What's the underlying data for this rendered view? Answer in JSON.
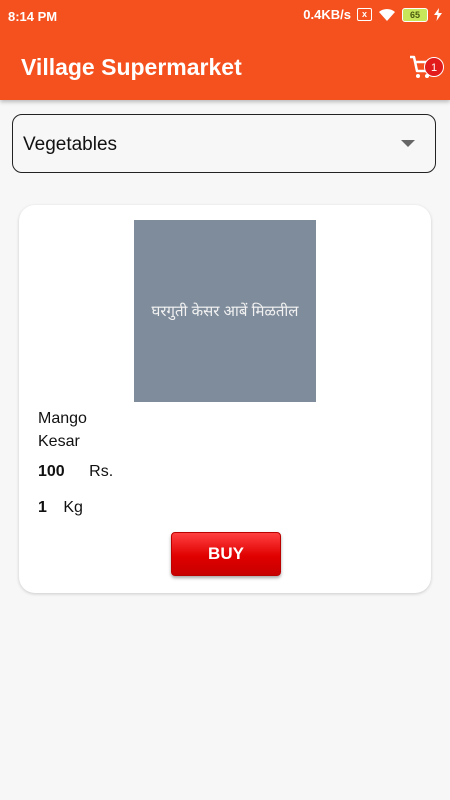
{
  "status_bar": {
    "time": "8:14 PM",
    "net_speed": "0.4KB/s",
    "sim_icon": "x",
    "battery": "65",
    "icons": [
      "sim-off-icon",
      "wifi-icon",
      "battery-icon",
      "charging-bolt-icon"
    ]
  },
  "app_bar": {
    "title": "Village Supermarket",
    "cart_count": "1",
    "color": "#f4511e"
  },
  "category": {
    "selected": "Vegetables"
  },
  "product": {
    "image_text": "घरगुती केसर आबें मिळतील",
    "name_line1": "Mango",
    "name_line2": "Kesar",
    "price": "100",
    "price_unit": "Rs.",
    "quantity": "1",
    "quantity_unit": "Kg",
    "buy_label": "BUY",
    "buy_color": "#e00000"
  }
}
